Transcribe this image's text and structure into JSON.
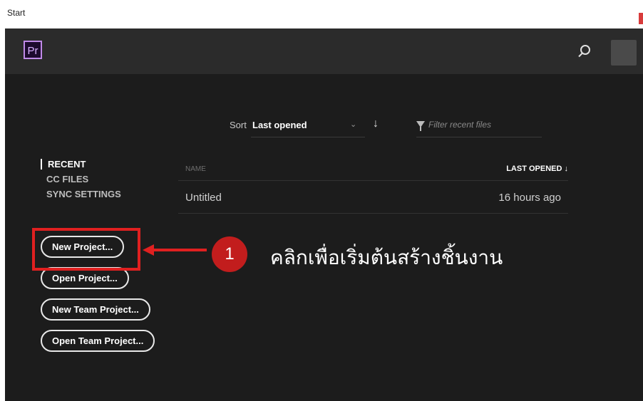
{
  "window": {
    "title": "Start"
  },
  "header": {
    "logo": "Pr",
    "search_icon": "search-icon"
  },
  "sort": {
    "label": "Sort",
    "value": "Last opened",
    "chevron": "⌄",
    "order_arrow": "↓"
  },
  "filter": {
    "placeholder": "Filter recent files"
  },
  "nav": {
    "items": [
      "RECENT",
      "CC FILES",
      "SYNC SETTINGS"
    ]
  },
  "table": {
    "headers": {
      "name": "NAME",
      "last_opened": "LAST OPENED ↓"
    },
    "rows": [
      {
        "name": "Untitled",
        "last_opened": "16 hours ago"
      }
    ]
  },
  "buttons": [
    "New Project...",
    "Open Project...",
    "New Team Project...",
    "Open Team Project..."
  ],
  "annotation": {
    "step": "1",
    "text": "คลิกเพื่อเริ่มต้นสร้างชิ้นงาน"
  },
  "colors": {
    "annotation_red": "#e02020",
    "background": "#1c1c1c",
    "header": "#2b2b2b"
  }
}
